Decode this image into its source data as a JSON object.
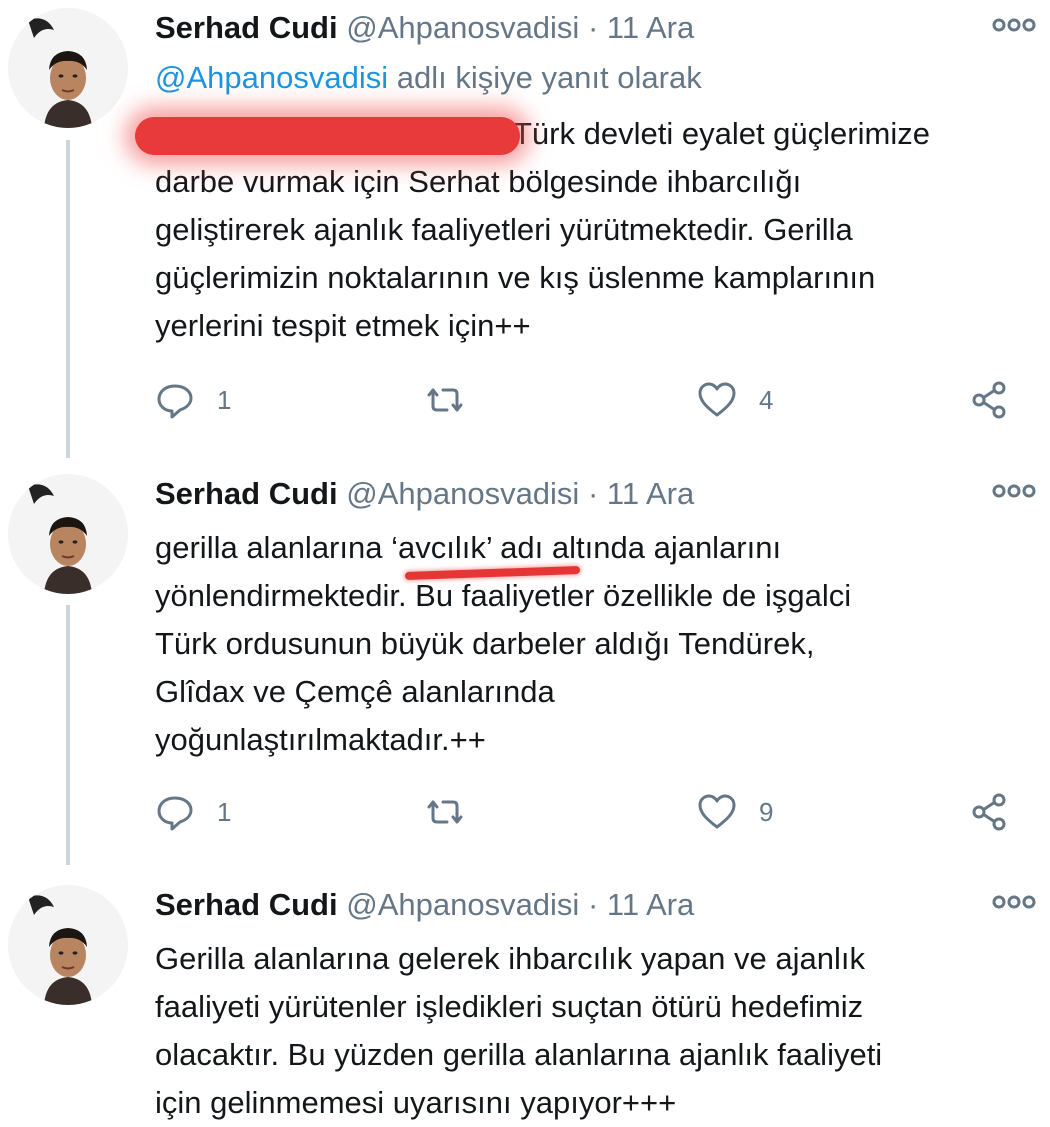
{
  "tweets": [
    {
      "author": {
        "name": "Serhad Cudi",
        "handle": "@Ahpanosvadisi"
      },
      "separator": "·",
      "date": "11 Ara",
      "reply_mention": "@Ahpanosvadisi",
      "reply_suffix": " adlı kişiye yanıt olarak",
      "text": "Türk devleti eyalet güçlerimize\ndarbe vurmak için Serhat bölgesinde ihbarcılığı\ngeliştirerek ajanlık faaliyetleri yürütmektedir. Gerilla\ngüçlerimizin noktalarının ve kış üslenme kamplarının\nyerlerini tespit etmek için++",
      "replies": "1",
      "likes": "4"
    },
    {
      "author": {
        "name": "Serhad Cudi",
        "handle": "@Ahpanosvadisi"
      },
      "separator": "·",
      "date": "11 Ara",
      "text": "gerilla alanlarına ‘avcılık’ adı altında ajanlarını\nyönlendirmektedir. Bu faaliyetler özellikle de işgalci\nTürk ordusunun büyük darbeler aldığı Tendürek,\nGlîdax ve Çemçê alanlarında\nyoğunlaştırılmaktadır.++",
      "replies": "1",
      "likes": "9"
    },
    {
      "author": {
        "name": "Serhad Cudi",
        "handle": "@Ahpanosvadisi"
      },
      "separator": "·",
      "date": "11 Ara",
      "text": "Gerilla alanlarına gelerek ihbarcılık yapan ve ajanlık\nfaaliyeti yürütenler işledikleri suçtan ötürü hedefimiz\nolacaktır. Bu yüzden gerilla alanlarına ajanlık faaliyeti\niçin gelinmemesi uyarısını yapıyor+++"
    }
  ],
  "icons": {
    "reply": "reply-icon",
    "retweet": "retweet-icon",
    "like": "heart-icon",
    "share": "share-icon",
    "more": "more-icon"
  },
  "colors": {
    "text": "#14171a",
    "secondary": "#657786",
    "link": "#1b95e0",
    "thread_line": "#ccd6dd",
    "annotation_red": "#e53535"
  }
}
